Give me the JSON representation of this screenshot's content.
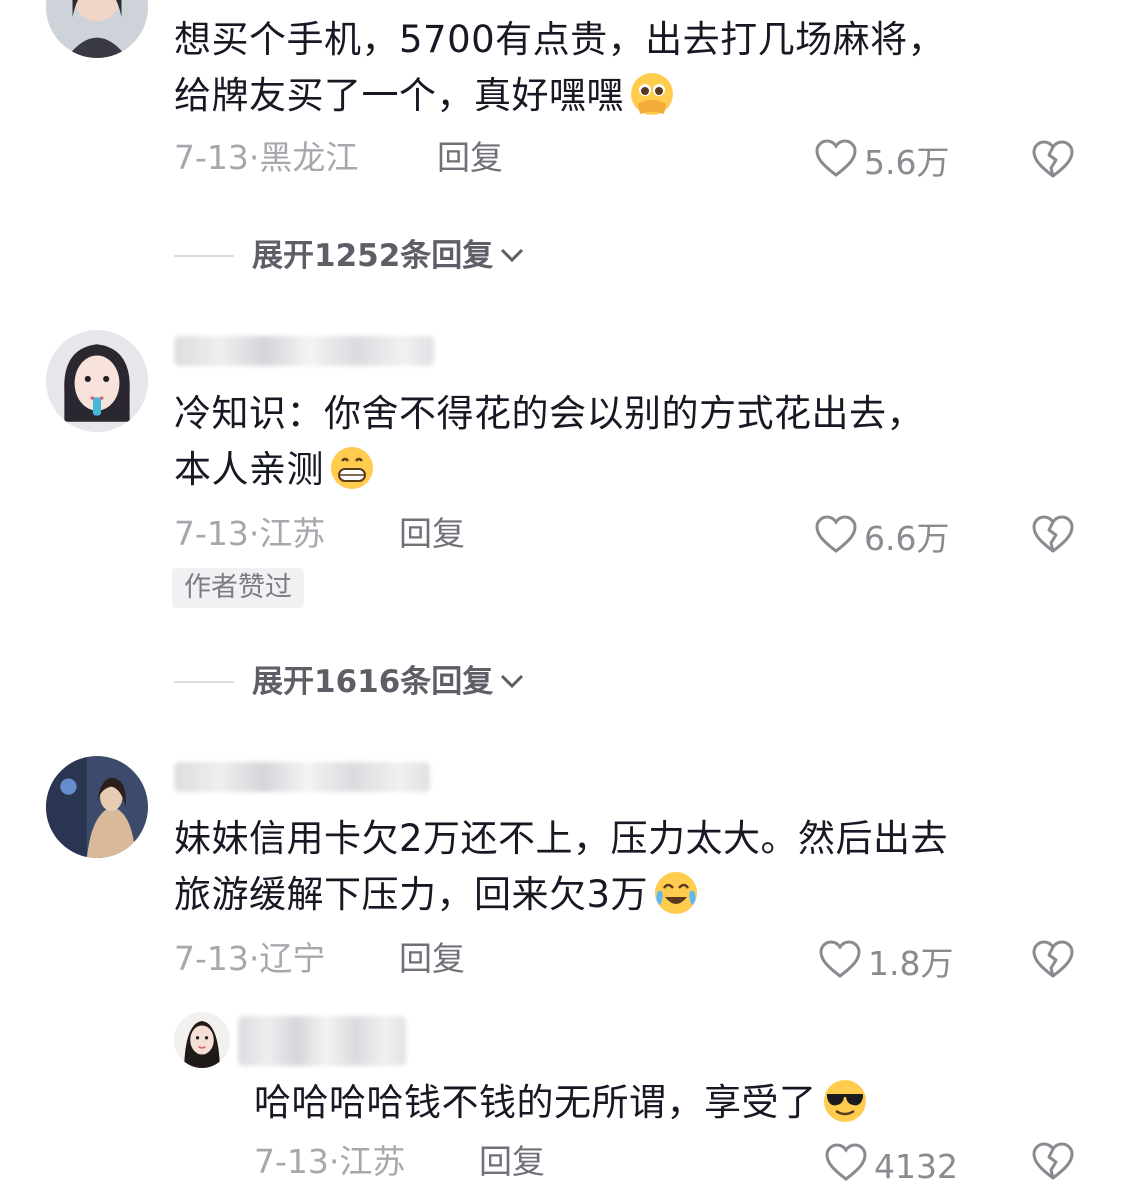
{
  "comments": [
    {
      "text_line1": "想买个手机，5700有点贵，出去打几场麻将，",
      "text_line2": "给牌友买了一个，真好嘿嘿",
      "emoji": "pleading-face-hands-emoji",
      "date": "7-13",
      "location": "黑龙江",
      "reply_label": "回复",
      "likes": "5.6万",
      "expand_label": "展开1252条回复"
    },
    {
      "text_line1": "冷知识：你舍不得花的会以别的方式花出去，",
      "text_line2": "本人亲测",
      "emoji": "grinning-face-emoji",
      "date": "7-13",
      "location": "江苏",
      "reply_label": "回复",
      "likes": "6.6万",
      "badge": "作者赞过",
      "expand_label": "展开1616条回复"
    },
    {
      "text_line1": "妹妹信用卡欠2万还不上，压力太大。然后出去",
      "text_line2": "旅游缓解下压力，回来欠3万",
      "emoji": "tears-of-joy-emoji",
      "date": "7-13",
      "location": "辽宁",
      "reply_label": "回复",
      "likes": "1.8万"
    },
    {
      "text_line1": "哈哈哈哈钱不钱的无所谓，享受了",
      "emoji": "sunglasses-face-emoji",
      "date": "7-13",
      "location": "江苏",
      "reply_label": "回复",
      "likes": "4132"
    }
  ],
  "separator": "·",
  "icons": {
    "like": "heart-outline-icon",
    "dislike": "broken-heart-icon",
    "expand": "chevron-down-icon"
  }
}
